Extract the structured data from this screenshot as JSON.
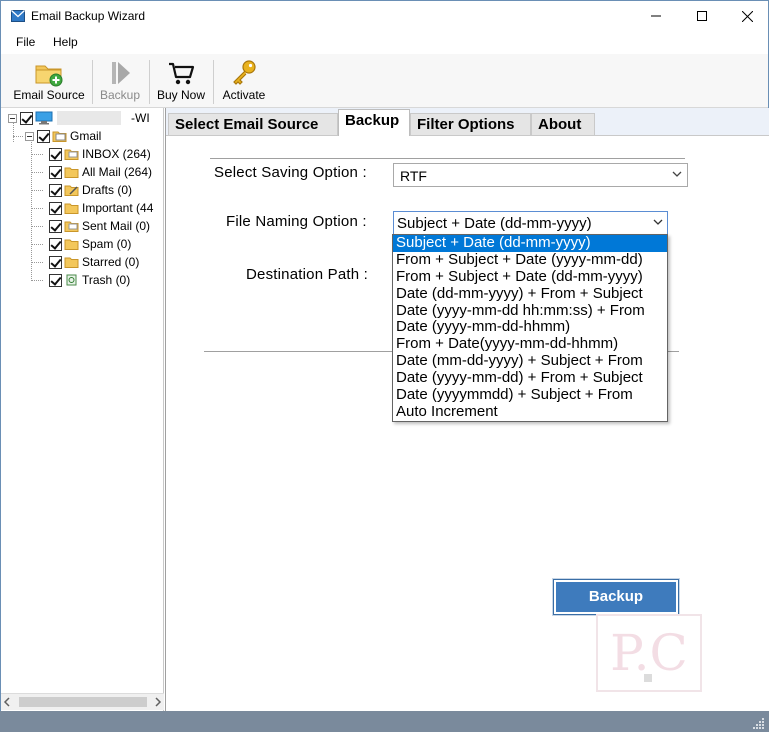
{
  "window": {
    "title": "Email Backup Wizard",
    "controls": {
      "minimize": "minimize",
      "maximize": "maximize",
      "close": "close"
    }
  },
  "menu": {
    "file": "File",
    "help": "Help"
  },
  "toolbar": {
    "email_source": "Email Source",
    "backup": "Backup",
    "buy_now": "Buy Now",
    "activate": "Activate"
  },
  "tree": {
    "root_label": "-WI",
    "account": "Gmail",
    "folders": [
      {
        "label": "INBOX (264)"
      },
      {
        "label": "All Mail (264)"
      },
      {
        "label": "Drafts (0)"
      },
      {
        "label": "Important (44"
      },
      {
        "label": "Sent Mail (0)"
      },
      {
        "label": "Spam (0)"
      },
      {
        "label": "Starred (0)"
      },
      {
        "label": "Trash (0)"
      }
    ]
  },
  "tabs": [
    {
      "label": "Select Email Source"
    },
    {
      "label": "Backup"
    },
    {
      "label": "Filter Options"
    },
    {
      "label": "About"
    }
  ],
  "form": {
    "saving_option_label": "Select Saving Option :",
    "saving_option_value": "RTF",
    "naming_option_label": "File Naming Option :",
    "naming_option_value": "Subject + Date (dd-mm-yyyy)",
    "destination_label": "Destination Path :",
    "naming_options": [
      "Subject + Date (dd-mm-yyyy)",
      "From + Subject + Date (yyyy-mm-dd)",
      "From + Subject + Date (dd-mm-yyyy)",
      "Date (dd-mm-yyyy) + From + Subject",
      "Date (yyyy-mm-dd hh:mm:ss) + From",
      "Date (yyyy-mm-dd-hhmm)",
      "From + Date(yyyy-mm-dd-hhmm)",
      "Date (mm-dd-yyyy) + Subject + From",
      "Date (yyyy-mm-dd) + From + Subject",
      "Date (yyyymmdd) + Subject + From",
      "Auto Increment"
    ],
    "backup_button": "Backup"
  },
  "watermark": "P.C",
  "colors": {
    "accent": "#0078d7",
    "button": "#3e7bbd",
    "statusbar": "#7a8a9c",
    "panel_bg": "#ecf1f9"
  }
}
